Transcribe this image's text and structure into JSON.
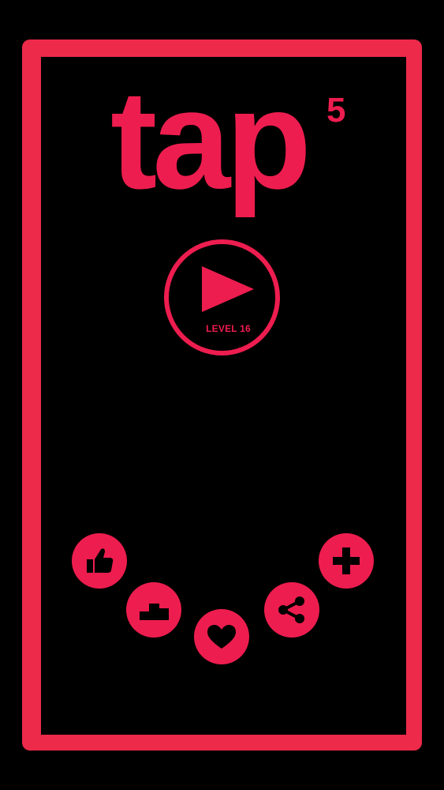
{
  "app": {
    "logo_word": "tap",
    "logo_superscript": "5"
  },
  "play": {
    "level_label": "LEVEL 16",
    "icon": "play-icon"
  },
  "menu": {
    "items": [
      {
        "name": "rate",
        "icon": "thumbs-up-icon"
      },
      {
        "name": "leaderboard",
        "icon": "podium-icon"
      },
      {
        "name": "favorite",
        "icon": "heart-icon"
      },
      {
        "name": "share",
        "icon": "share-icon"
      },
      {
        "name": "more",
        "icon": "plus-icon"
      }
    ]
  },
  "colors": {
    "accent": "#ee1d4f",
    "frame": "#ee2a4a",
    "background": "#000000"
  }
}
